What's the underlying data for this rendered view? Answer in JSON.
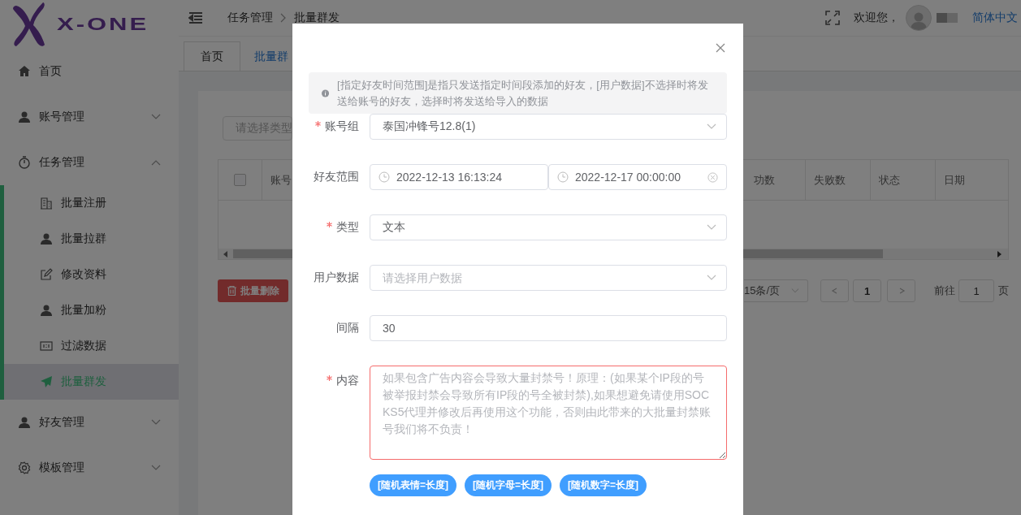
{
  "logo": {
    "text": "X-ONE"
  },
  "header": {
    "breadcrumb": [
      "任务管理",
      "批量群发"
    ],
    "welcome": "欢迎您，",
    "language": "简体中文"
  },
  "tabs": [
    {
      "label": "首页",
      "selected": false
    },
    {
      "label": "批量群",
      "selected": true
    }
  ],
  "sidebar": {
    "items": [
      {
        "label": "首页",
        "selected": false
      },
      {
        "label": "账号管理",
        "selected": false,
        "expanded": false
      },
      {
        "label": "任务管理",
        "selected": false,
        "expanded": true,
        "children": [
          {
            "label": "批量注册",
            "selected": false
          },
          {
            "label": "批量拉群",
            "selected": false
          },
          {
            "label": "修改资料",
            "selected": false
          },
          {
            "label": "批量加粉",
            "selected": false
          },
          {
            "label": "过滤数据",
            "selected": false
          },
          {
            "label": "批量群发",
            "selected": true
          }
        ]
      },
      {
        "label": "好友管理",
        "selected": false,
        "expanded": false
      },
      {
        "label": "模板管理",
        "selected": false,
        "expanded": false
      }
    ]
  },
  "filter": {
    "placeholder": "请选择类型"
  },
  "table": {
    "select_all_checked": false,
    "columns": [
      "账号",
      "功数",
      "失败数",
      "状态",
      "日期"
    ]
  },
  "delete_button": "批量删除",
  "pagination": {
    "page_size": "15条/页",
    "current_page": "1",
    "goto_label": "前往",
    "goto_value": "1",
    "page_suffix": "页"
  },
  "dialog": {
    "alert": "[指定好友时间范围]是指只发送指定时间段添加的好友，[用户数据]不选择时将发送给账号的好友，选择时将发送给导入的数据",
    "fields": [
      {
        "kind": "select",
        "label": "账号组",
        "required": true,
        "value": "泰国冲锋号12.8(1)"
      },
      {
        "kind": "daterange",
        "label": "好友范围",
        "required": false,
        "start": "2022-12-13 16:13:24",
        "end": "2022-12-17 00:00:00"
      },
      {
        "kind": "select",
        "label": "类型",
        "required": true,
        "value": "文本"
      },
      {
        "kind": "select",
        "label": "用户数据",
        "required": false,
        "placeholder": "请选择用户数据"
      },
      {
        "kind": "input",
        "label": "间隔",
        "required": false,
        "value": "30"
      },
      {
        "kind": "textarea",
        "label": "内容",
        "required": true,
        "error": true,
        "placeholder": "如果包含广告内容会导致大量封禁号！原理：(如果某个IP段的号被举报封禁会导致所有IP段的号全被封禁),如果想避免请使用SOCKS5代理并修改后再使用这个功能，否则由此带来的大批量封禁账号我们将不负责！"
      }
    ],
    "insert_tags": [
      "[随机表情=长度]",
      "[随机字母=长度]",
      "[随机数字=长度]"
    ]
  }
}
